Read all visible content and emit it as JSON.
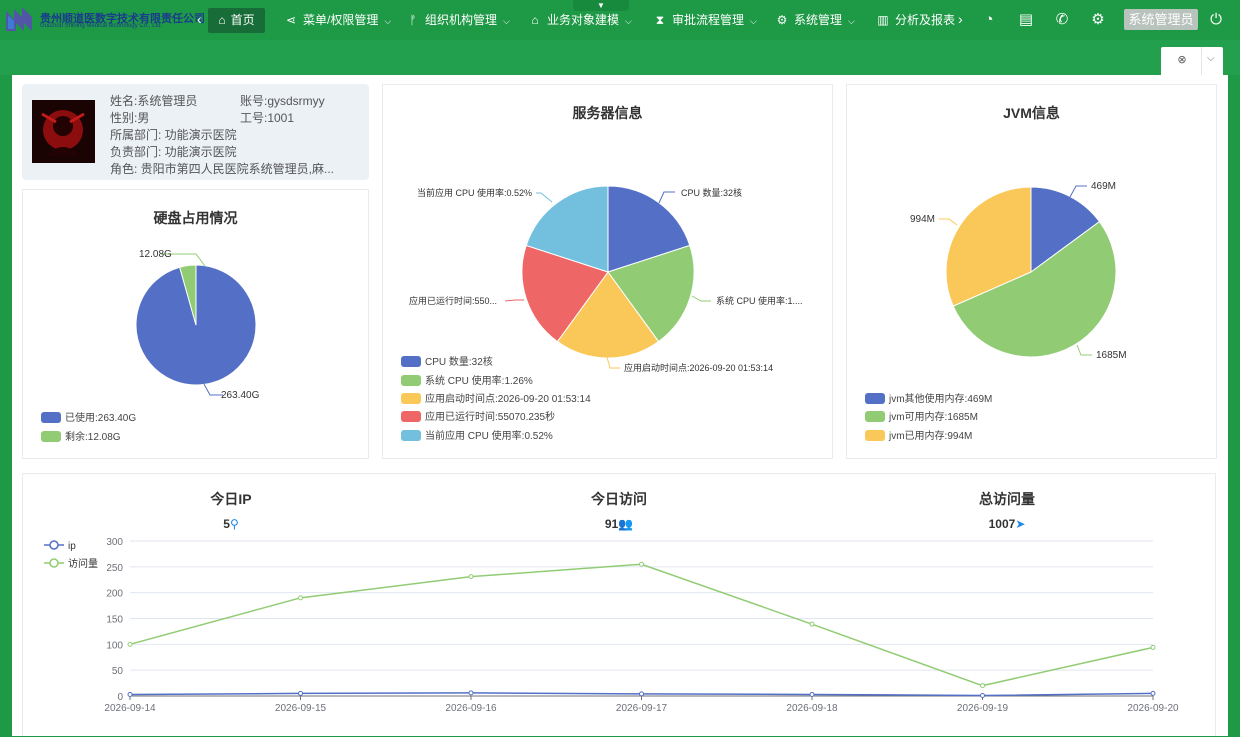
{
  "header": {
    "org_name": "贵州顺道医数字技术有限责任公司",
    "org_name_en": "GuiZhou Shining Medical technology Co., Ltd.",
    "nav_items": [
      {
        "label": "首页",
        "icon": "home-icon"
      },
      {
        "label": "菜单/权限管理",
        "icon": "share-icon"
      },
      {
        "label": "组织机构管理",
        "icon": "branch-icon"
      },
      {
        "label": "业务对象建模",
        "icon": "bank-icon"
      },
      {
        "label": "审批流程管理",
        "icon": "hourglass-icon"
      },
      {
        "label": "系统管理",
        "icon": "gear-icon"
      },
      {
        "label": "分析及报表",
        "icon": "bar-chart-icon"
      }
    ],
    "user_name": "系统管理员"
  },
  "profile": {
    "name": "姓名:系统管理员",
    "account": "账号:gysdsrmyy",
    "gender": "性别:男",
    "job_no": "工号:1001",
    "dept": "所属部门: 功能演示医院",
    "resp_dept": "负责部门: 功能演示医院",
    "role": "角色: 贵阳市第四人民医院系统管理员,麻..."
  },
  "disk": {
    "title": "硬盘占用情况",
    "label_used": "263.40G",
    "label_free": "12.08G",
    "legend": [
      "已使用:263.40G",
      "剩余:12.08G"
    ],
    "chart_data": {
      "type": "pie",
      "categories": [
        "已使用",
        "剩余"
      ],
      "values": [
        263.4,
        12.08
      ],
      "colors": [
        "#5470c6",
        "#91cc75"
      ]
    }
  },
  "server": {
    "title": "服务器信息",
    "labels": [
      "CPU 数量:32核",
      "系统 CPU 使用率:1....",
      "应用启动时间点:2026-09-20 01:53:14",
      "应用已运行时间:550...",
      "当前应用 CPU 使用率:0.52%"
    ],
    "legend": [
      "CPU 数量:32核",
      "系统 CPU 使用率:1.26%",
      "应用启动时间点:2026-09-20 01:53:14",
      "应用已运行时间:55070.235秒",
      "当前应用 CPU 使用率:0.52%"
    ],
    "chart_data": {
      "type": "pie",
      "categories": [
        "CPU 数量",
        "系统 CPU 使用率",
        "应用启动时间点",
        "应用已运行时间",
        "当前应用 CPU 使用率"
      ],
      "values": [
        1,
        1,
        1,
        1,
        1
      ],
      "colors": [
        "#5470c6",
        "#91cc75",
        "#fac858",
        "#ee6666",
        "#73c0de"
      ]
    }
  },
  "jvm": {
    "title": "JVM信息",
    "labels": [
      "469M",
      "1685M",
      "994M"
    ],
    "legend": [
      "jvm其他使用内存:469M",
      "jvm可用内存:1685M",
      "jvm已用内存:994M"
    ],
    "chart_data": {
      "type": "pie",
      "categories": [
        "jvm其他使用内存",
        "jvm可用内存",
        "jvm已用内存"
      ],
      "values": [
        469,
        1685,
        994
      ],
      "colors": [
        "#5470c6",
        "#91cc75",
        "#fac858"
      ]
    }
  },
  "stats": {
    "ip_label": "今日IP",
    "ip_value": "5",
    "visit_label": "今日访问",
    "visit_value": "91",
    "total_label": "总访问量",
    "total_value": "1007"
  },
  "chart_data": {
    "type": "line",
    "x": [
      "2026-09-14",
      "2026-09-15",
      "2026-09-16",
      "2026-09-17",
      "2026-09-18",
      "2026-09-19",
      "2026-09-20"
    ],
    "series": [
      {
        "name": "ip",
        "color": "#5470c6",
        "values": [
          3,
          5,
          6,
          4,
          3,
          1,
          5
        ]
      },
      {
        "name": "访问量",
        "color": "#91cc75",
        "values": [
          100,
          190,
          231,
          255,
          139,
          20,
          94
        ]
      }
    ],
    "ylim": [
      0,
      300
    ],
    "yticks": [
      0,
      50,
      100,
      150,
      200,
      250,
      300
    ],
    "grid": true,
    "legend_position": "top-left"
  }
}
